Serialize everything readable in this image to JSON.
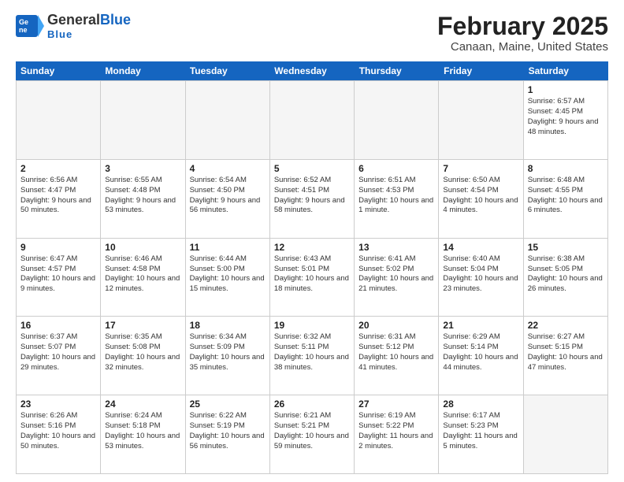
{
  "header": {
    "logo_general": "General",
    "logo_blue": "Blue",
    "month_title": "February 2025",
    "location": "Canaan, Maine, United States"
  },
  "days_of_week": [
    "Sunday",
    "Monday",
    "Tuesday",
    "Wednesday",
    "Thursday",
    "Friday",
    "Saturday"
  ],
  "weeks": [
    [
      {
        "day": "",
        "info": "",
        "empty": true
      },
      {
        "day": "",
        "info": "",
        "empty": true
      },
      {
        "day": "",
        "info": "",
        "empty": true
      },
      {
        "day": "",
        "info": "",
        "empty": true
      },
      {
        "day": "",
        "info": "",
        "empty": true
      },
      {
        "day": "",
        "info": "",
        "empty": true
      },
      {
        "day": "1",
        "info": "Sunrise: 6:57 AM\nSunset: 4:45 PM\nDaylight: 9 hours\nand 48 minutes."
      }
    ],
    [
      {
        "day": "2",
        "info": "Sunrise: 6:56 AM\nSunset: 4:47 PM\nDaylight: 9 hours\nand 50 minutes."
      },
      {
        "day": "3",
        "info": "Sunrise: 6:55 AM\nSunset: 4:48 PM\nDaylight: 9 hours\nand 53 minutes."
      },
      {
        "day": "4",
        "info": "Sunrise: 6:54 AM\nSunset: 4:50 PM\nDaylight: 9 hours\nand 56 minutes."
      },
      {
        "day": "5",
        "info": "Sunrise: 6:52 AM\nSunset: 4:51 PM\nDaylight: 9 hours\nand 58 minutes."
      },
      {
        "day": "6",
        "info": "Sunrise: 6:51 AM\nSunset: 4:53 PM\nDaylight: 10 hours\nand 1 minute."
      },
      {
        "day": "7",
        "info": "Sunrise: 6:50 AM\nSunset: 4:54 PM\nDaylight: 10 hours\nand 4 minutes."
      },
      {
        "day": "8",
        "info": "Sunrise: 6:48 AM\nSunset: 4:55 PM\nDaylight: 10 hours\nand 6 minutes."
      }
    ],
    [
      {
        "day": "9",
        "info": "Sunrise: 6:47 AM\nSunset: 4:57 PM\nDaylight: 10 hours\nand 9 minutes."
      },
      {
        "day": "10",
        "info": "Sunrise: 6:46 AM\nSunset: 4:58 PM\nDaylight: 10 hours\nand 12 minutes."
      },
      {
        "day": "11",
        "info": "Sunrise: 6:44 AM\nSunset: 5:00 PM\nDaylight: 10 hours\nand 15 minutes."
      },
      {
        "day": "12",
        "info": "Sunrise: 6:43 AM\nSunset: 5:01 PM\nDaylight: 10 hours\nand 18 minutes."
      },
      {
        "day": "13",
        "info": "Sunrise: 6:41 AM\nSunset: 5:02 PM\nDaylight: 10 hours\nand 21 minutes."
      },
      {
        "day": "14",
        "info": "Sunrise: 6:40 AM\nSunset: 5:04 PM\nDaylight: 10 hours\nand 23 minutes."
      },
      {
        "day": "15",
        "info": "Sunrise: 6:38 AM\nSunset: 5:05 PM\nDaylight: 10 hours\nand 26 minutes."
      }
    ],
    [
      {
        "day": "16",
        "info": "Sunrise: 6:37 AM\nSunset: 5:07 PM\nDaylight: 10 hours\nand 29 minutes."
      },
      {
        "day": "17",
        "info": "Sunrise: 6:35 AM\nSunset: 5:08 PM\nDaylight: 10 hours\nand 32 minutes."
      },
      {
        "day": "18",
        "info": "Sunrise: 6:34 AM\nSunset: 5:09 PM\nDaylight: 10 hours\nand 35 minutes."
      },
      {
        "day": "19",
        "info": "Sunrise: 6:32 AM\nSunset: 5:11 PM\nDaylight: 10 hours\nand 38 minutes."
      },
      {
        "day": "20",
        "info": "Sunrise: 6:31 AM\nSunset: 5:12 PM\nDaylight: 10 hours\nand 41 minutes."
      },
      {
        "day": "21",
        "info": "Sunrise: 6:29 AM\nSunset: 5:14 PM\nDaylight: 10 hours\nand 44 minutes."
      },
      {
        "day": "22",
        "info": "Sunrise: 6:27 AM\nSunset: 5:15 PM\nDaylight: 10 hours\nand 47 minutes."
      }
    ],
    [
      {
        "day": "23",
        "info": "Sunrise: 6:26 AM\nSunset: 5:16 PM\nDaylight: 10 hours\nand 50 minutes."
      },
      {
        "day": "24",
        "info": "Sunrise: 6:24 AM\nSunset: 5:18 PM\nDaylight: 10 hours\nand 53 minutes."
      },
      {
        "day": "25",
        "info": "Sunrise: 6:22 AM\nSunset: 5:19 PM\nDaylight: 10 hours\nand 56 minutes."
      },
      {
        "day": "26",
        "info": "Sunrise: 6:21 AM\nSunset: 5:21 PM\nDaylight: 10 hours\nand 59 minutes."
      },
      {
        "day": "27",
        "info": "Sunrise: 6:19 AM\nSunset: 5:22 PM\nDaylight: 11 hours\nand 2 minutes."
      },
      {
        "day": "28",
        "info": "Sunrise: 6:17 AM\nSunset: 5:23 PM\nDaylight: 11 hours\nand 5 minutes."
      },
      {
        "day": "",
        "info": "",
        "empty": true
      }
    ]
  ]
}
